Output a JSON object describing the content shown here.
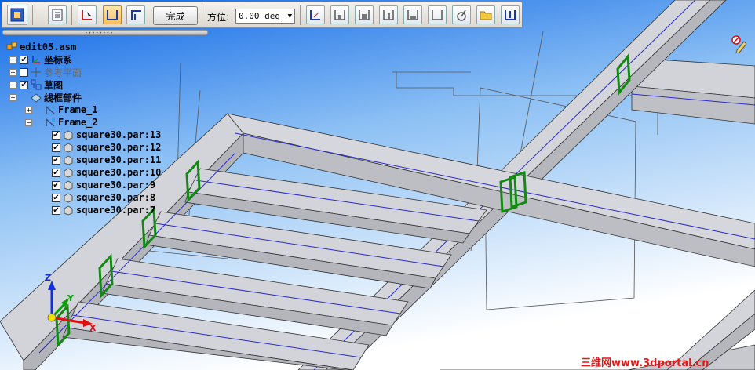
{
  "toolbar": {
    "done_label": "完成",
    "angle_label": "方位:",
    "angle_value": "0.00 deg",
    "icons": [
      "select-frame-icon",
      "properties-icon",
      "rotate-cursor-icon",
      "end-cap-icon",
      "miter-corner-icon",
      "frame-end-1-icon",
      "frame-end-2-icon",
      "frame-end-3-icon",
      "frame-end-4-icon",
      "frame-end-5-icon",
      "frame-end-6-icon",
      "orientation-icon",
      "folder-icon",
      "trim-icon"
    ]
  },
  "tree": {
    "root": "edit05.asm",
    "items": [
      {
        "label": "坐标系",
        "checked": true,
        "dim": false
      },
      {
        "label": "参考平面",
        "checked": false,
        "dim": true
      },
      {
        "label": "草图",
        "checked": true,
        "dim": false
      },
      {
        "label": "线框部件",
        "checked": null,
        "dim": false
      }
    ],
    "frames": [
      "Frame_1",
      "Frame_2"
    ],
    "parts": [
      "square30.par:13",
      "square30.par:12",
      "square30.par:11",
      "square30.par:10",
      "square30.par:9",
      "square30.par:8",
      "square30.par:7"
    ]
  },
  "axes": {
    "z": "Z",
    "y": "Y",
    "x": "X"
  },
  "watermark": "三维网www.3dportal.cn",
  "colors": {
    "background_top": "#0a64e6",
    "background_bottom": "#ffffff",
    "beam": "#cfd0d6",
    "highlight": "#1a8a1a",
    "centerline": "#1a1acc"
  }
}
